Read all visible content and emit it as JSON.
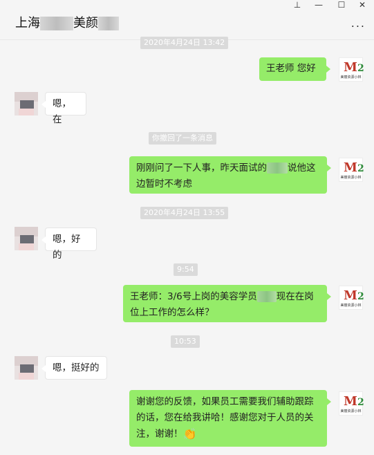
{
  "window": {
    "title_prefix": "上海",
    "title_mid": "美颜",
    "pin_icon": "pin-icon",
    "minimize_icon": "minimize-icon",
    "maximize_icon": "maximize-icon",
    "close_icon": "close-icon",
    "more_label": "..."
  },
  "messages": [
    {
      "type": "time",
      "text": "2020年4月24日 13:42"
    },
    {
      "type": "out",
      "text": "王老师  您好"
    },
    {
      "type": "in",
      "text": "嗯，在"
    },
    {
      "type": "system",
      "text": "你撤回了一条消息"
    },
    {
      "type": "out",
      "text_before": "刚刚问了一下人事，昨天面试的",
      "text_after": "说他这边暂时不考虑"
    },
    {
      "type": "time",
      "text": "2020年4月24日 13:55"
    },
    {
      "type": "in",
      "text": "嗯，好的"
    },
    {
      "type": "time",
      "text": "9:54"
    },
    {
      "type": "out",
      "text_before": "王老师：3/6号上岗的美容学员",
      "text_after": "现在在岗位上工作的怎么样？"
    },
    {
      "type": "time",
      "text": "10:53"
    },
    {
      "type": "in",
      "text": "嗯，挺好的"
    },
    {
      "type": "out",
      "text": "谢谢您的反馈，如果员工需要我们辅助跟踪的话，您在给我讲哈！感谢您对于人员的关注，谢谢！",
      "emoji": "clap-emoji"
    }
  ],
  "logo": {
    "mark": "M",
    "accent": "2",
    "caption": "美丽资源小林"
  },
  "colors": {
    "bubble_out": "#95ec69",
    "bubble_in": "#ffffff",
    "time_bg": "#dadada",
    "background": "#f5f5f5"
  }
}
